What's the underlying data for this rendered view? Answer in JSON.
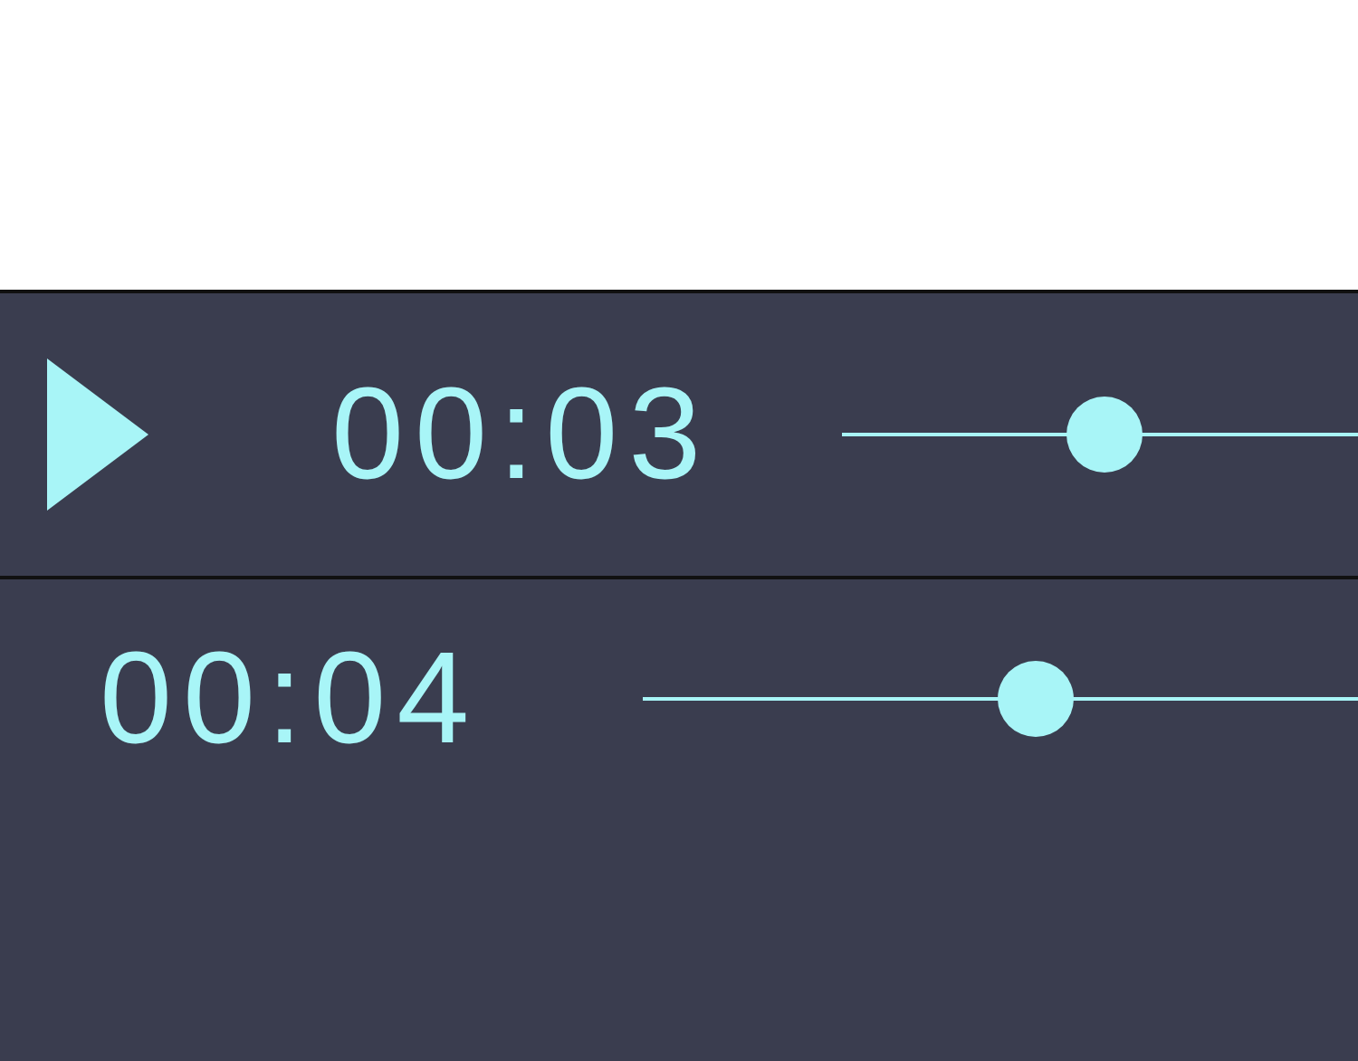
{
  "players": [
    {
      "kind": "with-play",
      "time": "00:03",
      "level": 0.51
    },
    {
      "kind": "plain",
      "time": "00:04",
      "level": 0.55
    }
  ]
}
